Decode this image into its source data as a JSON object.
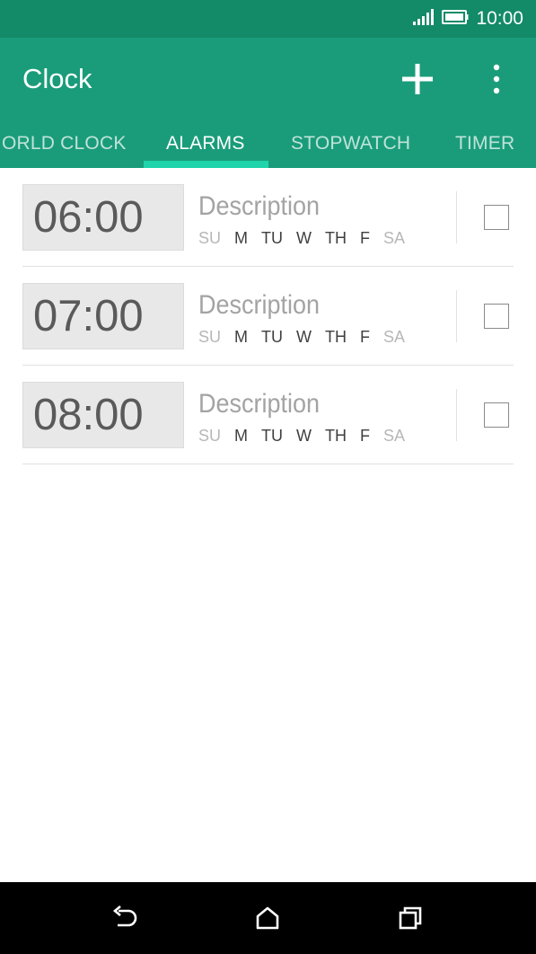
{
  "status_bar": {
    "time": "10:00"
  },
  "app_bar": {
    "title": "Clock"
  },
  "tabs": [
    {
      "label": "ORLD CLOCK",
      "active": false
    },
    {
      "label": "ALARMS",
      "active": true
    },
    {
      "label": "STOPWATCH",
      "active": false
    },
    {
      "label": "TIMER",
      "active": false
    }
  ],
  "alarms": [
    {
      "time": "06:00",
      "description": "Description",
      "days": [
        "SU",
        "M",
        "TU",
        "W",
        "TH",
        "F",
        "SA"
      ],
      "checked": false
    },
    {
      "time": "07:00",
      "description": "Description",
      "days": [
        "SU",
        "M",
        "TU",
        "W",
        "TH",
        "F",
        "SA"
      ],
      "checked": false
    },
    {
      "time": "08:00",
      "description": "Description",
      "days": [
        "SU",
        "M",
        "TU",
        "W",
        "TH",
        "F",
        "SA"
      ],
      "checked": false
    }
  ],
  "icons": {
    "signal": "signal-icon",
    "battery": "battery-icon",
    "add": "add-icon",
    "overflow": "overflow-menu-icon",
    "back": "back-icon",
    "home": "home-icon",
    "recents": "recents-icon"
  },
  "colors": {
    "status_bar": "#138a68",
    "app_bar": "#1a9c7a",
    "tab_indicator": "#1fd4aa"
  }
}
